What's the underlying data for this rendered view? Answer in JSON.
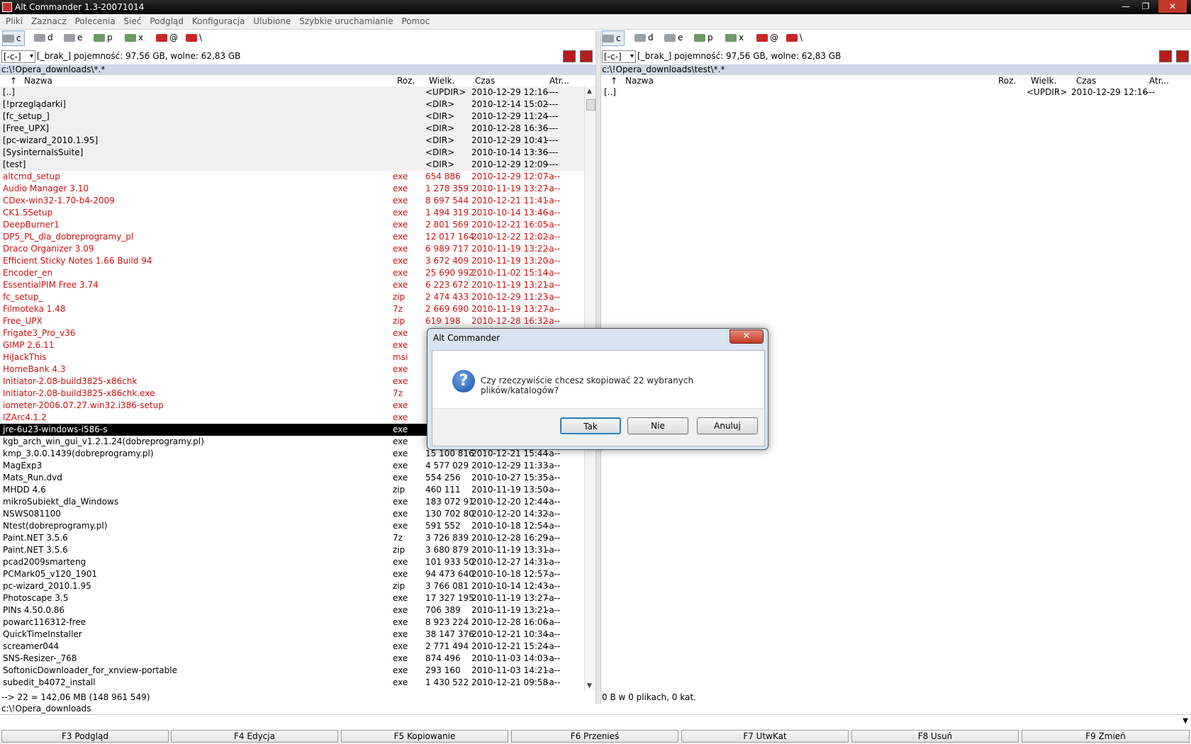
{
  "window": {
    "title": "Alt Commander 1.3-20071014",
    "min": "—",
    "max": "❐",
    "close": "✕"
  },
  "menu": [
    "Pliki",
    "Zaznacz",
    "Polecenia",
    "Sieć",
    "Podgląd",
    "Konfiguracja",
    "Ulubione",
    "Szybkie uruchamianie",
    "Pomoc"
  ],
  "drives": [
    "c",
    "d",
    "e",
    "p",
    "x",
    "@",
    "\\"
  ],
  "left": {
    "drive_combo": "[-c-]",
    "drive_info": "[_brak_]  pojemność: 97,56 GB, wolne: 62,83 GB",
    "path": "c:\\!Opera_downloads\\*.*",
    "status": "--> 22 = 142,06 MB (148 961 549)"
  },
  "right": {
    "drive_combo": "[-c-]",
    "drive_info": "[_brak_]  pojemność: 97,56 GB, wolne: 62,83 GB",
    "path": "c:\\!Opera_downloads\\test\\*.*",
    "status": "0 B w 0 plikach, 0 kat.",
    "rows": [
      {
        "name": "[..]",
        "ext": "",
        "size": "<UPDIR>",
        "time": "2010-12-29 12:16",
        "attr": "----"
      }
    ]
  },
  "columns": {
    "sort": "↑",
    "name": "Nazwa",
    "ext": "Roz.",
    "size": "Wielk.",
    "time": "Czas",
    "attr": "Atr..."
  },
  "files": [
    {
      "name": "[..]",
      "ext": "",
      "size": "<UPDIR>",
      "time": "2010-12-29 12:16",
      "attr": "----",
      "kind": "dir"
    },
    {
      "name": "[!przeglądarki]",
      "ext": "",
      "size": "<DIR>",
      "time": "2010-12-14 15:02",
      "attr": "----",
      "kind": "dir"
    },
    {
      "name": "[fc_setup_]",
      "ext": "",
      "size": "<DIR>",
      "time": "2010-12-29 11:24",
      "attr": "----",
      "kind": "dir"
    },
    {
      "name": "[Free_UPX]",
      "ext": "",
      "size": "<DIR>",
      "time": "2010-12-28 16:36",
      "attr": "----",
      "kind": "dir"
    },
    {
      "name": "[pc-wizard_2010.1.95]",
      "ext": "",
      "size": "<DIR>",
      "time": "2010-12-29 10:41",
      "attr": "----",
      "kind": "dir"
    },
    {
      "name": "[SysinternalsSuite]",
      "ext": "",
      "size": "<DIR>",
      "time": "2010-10-14 13:36",
      "attr": "----",
      "kind": "dir"
    },
    {
      "name": "[test]",
      "ext": "",
      "size": "<DIR>",
      "time": "2010-12-29 12:09",
      "attr": "----",
      "kind": "dir"
    },
    {
      "name": "altcmd_setup",
      "ext": "exe",
      "size": "654 886",
      "time": "2010-12-29 12:07",
      "attr": "-a--",
      "kind": "exe"
    },
    {
      "name": "Audio Manager 3.10",
      "ext": "exe",
      "size": "1 278 359",
      "time": "2010-11-19 13:27",
      "attr": "-a--",
      "kind": "exe"
    },
    {
      "name": "CDex-win32-1.70-b4-2009",
      "ext": "exe",
      "size": "8 697 544",
      "time": "2010-12-21 11:41",
      "attr": "-a--",
      "kind": "exe"
    },
    {
      "name": "CK1.5Setup",
      "ext": "exe",
      "size": "1 494 319",
      "time": "2010-10-14 13:46",
      "attr": "-a--",
      "kind": "exe"
    },
    {
      "name": "DeepBurner1",
      "ext": "exe",
      "size": "2 801 569",
      "time": "2010-12-21 16:05",
      "attr": "-a--",
      "kind": "exe"
    },
    {
      "name": "DP5_PL_dla_dobreprogramy_pl",
      "ext": "exe",
      "size": "12 017 164",
      "time": "2010-12-22 12:02",
      "attr": "-a--",
      "kind": "exe"
    },
    {
      "name": "Draco Organizer 3.09",
      "ext": "exe",
      "size": "6 989 717",
      "time": "2010-11-19 13:22",
      "attr": "-a--",
      "kind": "exe"
    },
    {
      "name": "Efficient Sticky Notes 1.66 Build 94",
      "ext": "exe",
      "size": "3 672 409",
      "time": "2010-11-19 13:20",
      "attr": "-a--",
      "kind": "exe"
    },
    {
      "name": "Encoder_en",
      "ext": "exe",
      "size": "25 690 992",
      "time": "2010-11-02 15:14",
      "attr": "-a--",
      "kind": "exe"
    },
    {
      "name": "EssentialPIM Free 3.74",
      "ext": "exe",
      "size": "6 223 672",
      "time": "2010-11-19 13:21",
      "attr": "-a--",
      "kind": "exe"
    },
    {
      "name": "fc_setup_",
      "ext": "zip",
      "size": "2 474 433",
      "time": "2010-12-29 11:23",
      "attr": "-a--",
      "kind": "exe"
    },
    {
      "name": "Filmoteka 1.48",
      "ext": "7z",
      "size": "2 669 690",
      "time": "2010-11-19 13:27",
      "attr": "-a--",
      "kind": "exe"
    },
    {
      "name": "Free_UPX",
      "ext": "zip",
      "size": "619 198",
      "time": "2010-12-28 16:32",
      "attr": "-a--",
      "kind": "exe"
    },
    {
      "name": "Frigate3_Pro_v36",
      "ext": "exe",
      "size": "",
      "time": "",
      "attr": "",
      "kind": "exe"
    },
    {
      "name": "GIMP 2.6.11",
      "ext": "exe",
      "size": "",
      "time": "",
      "attr": "",
      "kind": "exe"
    },
    {
      "name": "HiJackThis",
      "ext": "msi",
      "size": "",
      "time": "",
      "attr": "",
      "kind": "exe"
    },
    {
      "name": "HomeBank 4.3",
      "ext": "exe",
      "size": "",
      "time": "",
      "attr": "",
      "kind": "exe"
    },
    {
      "name": "Initiator-2.08-build3825-x86chk",
      "ext": "exe",
      "size": "",
      "time": "",
      "attr": "",
      "kind": "exe"
    },
    {
      "name": "Initiator-2.08-build3825-x86chk.exe",
      "ext": "7z",
      "size": "",
      "time": "",
      "attr": "",
      "kind": "exe"
    },
    {
      "name": "iometer-2006.07.27.win32.i386-setup",
      "ext": "exe",
      "size": "",
      "time": "",
      "attr": "",
      "kind": "exe"
    },
    {
      "name": "IZArc4.1.2",
      "ext": "exe",
      "size": "",
      "time": "",
      "attr": "",
      "kind": "exe"
    },
    {
      "name": "jre-6u23-windows-i586-s",
      "ext": "exe",
      "size": "",
      "time": "",
      "attr": "",
      "kind": "sel"
    },
    {
      "name": "kgb_arch_win_gui_v1.2.1.24(dobreprogramy.pl)",
      "ext": "exe",
      "size": "",
      "time": "",
      "attr": "",
      "kind": "file"
    },
    {
      "name": "kmp_3.0.0.1439(dobreprogramy.pl)",
      "ext": "exe",
      "size": "15 100 816",
      "time": "2010-12-21 15:44",
      "attr": "-a--",
      "kind": "file"
    },
    {
      "name": "MagExp3",
      "ext": "exe",
      "size": "4 577 029",
      "time": "2010-12-29 11:33",
      "attr": "-a--",
      "kind": "file"
    },
    {
      "name": "Mats_Run.dvd",
      "ext": "exe",
      "size": "554 256",
      "time": "2010-10-27 15:35",
      "attr": "-a--",
      "kind": "file"
    },
    {
      "name": "MHDD 4.6",
      "ext": "zip",
      "size": "460 111",
      "time": "2010-11-19 13:50",
      "attr": "-a--",
      "kind": "file"
    },
    {
      "name": "mikroSubiekt_dla_Windows",
      "ext": "exe",
      "size": "183 072 91",
      "time": "2010-12-20 12:44",
      "attr": "-a--",
      "kind": "file"
    },
    {
      "name": "NSWS081100",
      "ext": "exe",
      "size": "130 702 80",
      "time": "2010-12-20 14:32",
      "attr": "-a--",
      "kind": "file"
    },
    {
      "name": "Ntest(dobreprogramy.pl)",
      "ext": "exe",
      "size": "591 552",
      "time": "2010-10-18 12:54",
      "attr": "-a--",
      "kind": "file"
    },
    {
      "name": "Paint.NET 3.5.6",
      "ext": "7z",
      "size": "3 726 839",
      "time": "2010-12-28 16:29",
      "attr": "-a--",
      "kind": "file"
    },
    {
      "name": "Paint.NET 3.5.6",
      "ext": "zip",
      "size": "3 680 879",
      "time": "2010-11-19 13:31",
      "attr": "-a--",
      "kind": "file"
    },
    {
      "name": "pcad2009smarteng",
      "ext": "exe",
      "size": "101 933 50",
      "time": "2010-12-27 14:31",
      "attr": "-a--",
      "kind": "file"
    },
    {
      "name": "PCMark05_v120_1901",
      "ext": "exe",
      "size": "94 473 640",
      "time": "2010-10-18 12:57",
      "attr": "-a--",
      "kind": "file"
    },
    {
      "name": "pc-wizard_2010.1.95",
      "ext": "zip",
      "size": "3 766 081",
      "time": "2010-10-14 12:43",
      "attr": "-a--",
      "kind": "file"
    },
    {
      "name": "Photoscape 3.5",
      "ext": "exe",
      "size": "17 327 195",
      "time": "2010-11-19 13:27",
      "attr": "-a--",
      "kind": "file"
    },
    {
      "name": "PINs 4.50.0.86",
      "ext": "exe",
      "size": "706 389",
      "time": "2010-11-19 13:21",
      "attr": "-a--",
      "kind": "file"
    },
    {
      "name": "powarc116312-free",
      "ext": "exe",
      "size": "8 923 224",
      "time": "2010-12-28 16:06",
      "attr": "-a--",
      "kind": "file"
    },
    {
      "name": "QuickTimeInstaller",
      "ext": "exe",
      "size": "38 147 376",
      "time": "2010-12-21 10:34",
      "attr": "-a--",
      "kind": "file"
    },
    {
      "name": "screamer044",
      "ext": "exe",
      "size": "2 771 494",
      "time": "2010-12-21 15:24",
      "attr": "-a--",
      "kind": "file"
    },
    {
      "name": "SNS-Resizer-_768",
      "ext": "exe",
      "size": "874 496",
      "time": "2010-11-03 14:03",
      "attr": "-a--",
      "kind": "file"
    },
    {
      "name": "SoftonicDownloader_for_xnview-portable",
      "ext": "exe",
      "size": "293 160",
      "time": "2010-11-03 14:21",
      "attr": "-a--",
      "kind": "file"
    },
    {
      "name": "subedit_b4072_install",
      "ext": "exe",
      "size": "1 430 522",
      "time": "2010-12-21 09:58",
      "attr": "-a--",
      "kind": "file"
    }
  ],
  "cmd_path": "c:\\!Opera_downloads",
  "fkeys": [
    "F3 Podgląd",
    "F4 Edycja",
    "F5 Kopiowanie",
    "F6 Przenieś",
    "F7 UtwKat",
    "F8 Usuń",
    "F9 Zmień"
  ],
  "dialog": {
    "title": "Alt Commander",
    "message": "Czy rzeczywiście chcesz skopiować 22 wybranych plików/katalogów?",
    "yes": "Tak",
    "no": "Nie",
    "cancel": "Anuluj"
  }
}
